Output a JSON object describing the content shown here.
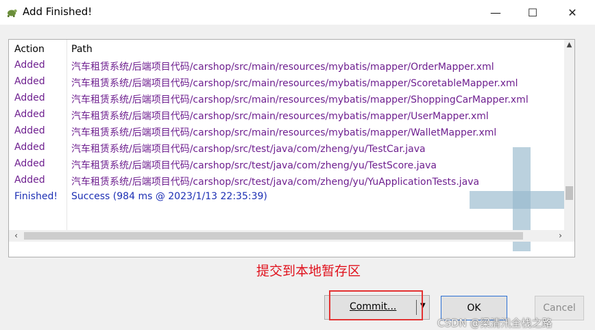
{
  "window": {
    "title": "Add Finished!",
    "controls": {
      "minimize": "—",
      "maximize": "☐",
      "close": "✕"
    }
  },
  "log_table": {
    "columns": {
      "action": "Action",
      "path": "Path"
    },
    "rows": [
      {
        "action": "Added",
        "path": "汽车租赁系统/后端项目代码/carshop/src/main/resources/mybatis/mapper/OrderMapper.xml"
      },
      {
        "action": "Added",
        "path": "汽车租赁系统/后端项目代码/carshop/src/main/resources/mybatis/mapper/ScoretableMapper.xml"
      },
      {
        "action": "Added",
        "path": "汽车租赁系统/后端项目代码/carshop/src/main/resources/mybatis/mapper/ShoppingCarMapper.xml"
      },
      {
        "action": "Added",
        "path": "汽车租赁系统/后端项目代码/carshop/src/main/resources/mybatis/mapper/UserMapper.xml"
      },
      {
        "action": "Added",
        "path": "汽车租赁系统/后端项目代码/carshop/src/main/resources/mybatis/mapper/WalletMapper.xml"
      },
      {
        "action": "Added",
        "path": "汽车租赁系统/后端项目代码/carshop/src/test/java/com/zheng/yu/TestCar.java"
      },
      {
        "action": "Added",
        "path": "汽车租赁系统/后端项目代码/carshop/src/test/java/com/zheng/yu/TestScore.java"
      },
      {
        "action": "Added",
        "path": "汽车租赁系统/后端项目代码/carshop/src/test/java/com/zheng/yu/YuApplicationTests.java"
      },
      {
        "action": "Finished!",
        "path": "Success (984 ms @ 2023/1/13 22:35:39)"
      }
    ]
  },
  "annotation": "提交到本地暂存区",
  "buttons": {
    "commit": "Commit...",
    "ok": "OK",
    "cancel": "Cancel"
  },
  "watermark": "CSDN @梁清汛全栈之路",
  "colors": {
    "added_text": "#6e1f8f",
    "finished_text": "#1c2fb4",
    "annotation": "#e0121d"
  }
}
